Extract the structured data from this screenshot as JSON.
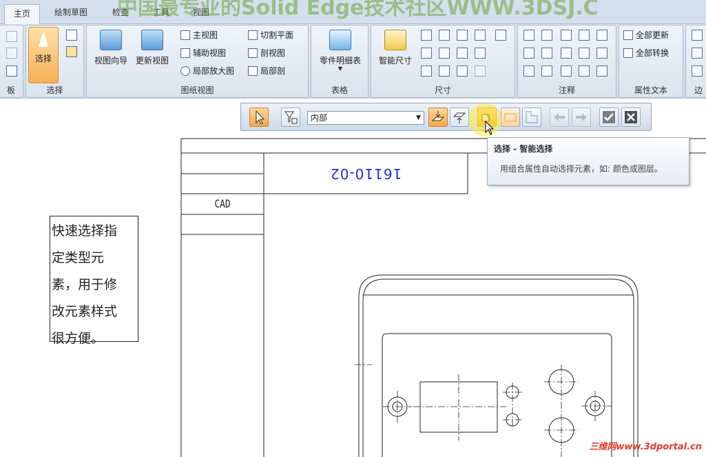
{
  "banner": "中国最专业的Solid Edge技术社区WWW.3DSJ.C",
  "tabs": [
    "主页",
    "绘制草图",
    "检查",
    "工具",
    "视图"
  ],
  "groups": {
    "clipboard": {
      "label": "板"
    },
    "select": {
      "label": "选择",
      "button": "选择"
    },
    "drawing_views": {
      "label": "图纸视图",
      "view_wizard": "视图向导",
      "update_views": "更新视图",
      "items": [
        "主视图",
        "辅助视图",
        "局部放大图",
        "切割平面",
        "剖视图",
        "局部剖"
      ]
    },
    "tables": {
      "label": "表格",
      "parts_list": "零件明细表"
    },
    "dimension": {
      "label": "尺寸",
      "smart_dimension": "智能尺寸"
    },
    "annotation": {
      "label": "注释"
    },
    "property_text": {
      "label": "属性文本",
      "update_all": "全部更新",
      "convert_all": "全部转换"
    },
    "edge": {
      "label": "边"
    }
  },
  "cmdbar": {
    "filter_value": "内部"
  },
  "tooltip": {
    "title": "选择 - 智能选择",
    "body": "用组合属性自动选择元素，如: 颜色或图层。"
  },
  "drawing": {
    "part_number": "16110-02",
    "cad_label": "CAD",
    "note_lines": [
      "快速选择指",
      "定类型元",
      "素，用于修",
      "改元素样式",
      "很方便。"
    ]
  },
  "watermark": "三维网www.3dportal.cn",
  "colors": {
    "accent": "#f3a74a",
    "part_number": "#1f2fd0",
    "watermark": "#e23a2a"
  }
}
